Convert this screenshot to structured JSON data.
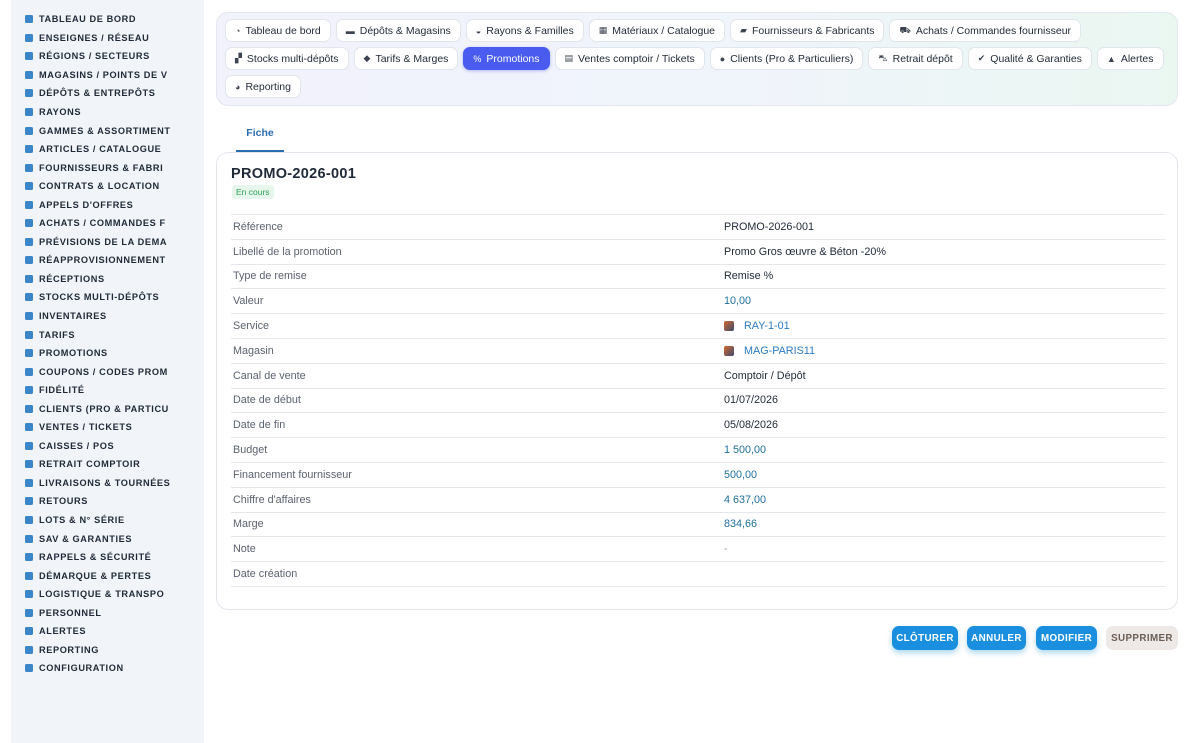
{
  "sidebar": {
    "items": [
      {
        "label": "TABLEAU DE BORD",
        "icon": "dashboard-icon"
      },
      {
        "label": "ENSEIGNES / RÉSEAU",
        "icon": "flag-icon"
      },
      {
        "label": "RÉGIONS / SECTEURS",
        "icon": "map-icon"
      },
      {
        "label": "MAGASINS / POINTS DE V",
        "icon": "store-icon"
      },
      {
        "label": "DÉPÔTS & ENTREPÔTS",
        "icon": "warehouse-icon"
      },
      {
        "label": "RAYONS",
        "icon": "shelf-icon"
      },
      {
        "label": "GAMMES & ASSORTIMENT",
        "icon": "box-icon"
      },
      {
        "label": "ARTICLES / CATALOGUE",
        "icon": "catalog-icon"
      },
      {
        "label": "FOURNISSEURS & FABRI",
        "icon": "truck-icon"
      },
      {
        "label": "CONTRATS & LOCATION",
        "icon": "document-icon"
      },
      {
        "label": "APPELS D'OFFRES",
        "icon": "hammer-icon"
      },
      {
        "label": "ACHATS / COMMANDES F",
        "icon": "cart-icon"
      },
      {
        "label": "PRÉVISIONS DE LA DEMA",
        "icon": "trend-icon"
      },
      {
        "label": "RÉAPPROVISIONNEMENT",
        "icon": "refresh-icon"
      },
      {
        "label": "RÉCEPTIONS",
        "icon": "dolly-icon"
      },
      {
        "label": "STOCKS MULTI-DÉPÔTS",
        "icon": "stock-icon"
      },
      {
        "label": "INVENTAIRES",
        "icon": "clipboard-icon"
      },
      {
        "label": "TARIFS",
        "icon": "tag-icon"
      },
      {
        "label": "PROMOTIONS",
        "icon": "percent-icon"
      },
      {
        "label": "COUPONS / CODES PROM",
        "icon": "ticket-icon"
      },
      {
        "label": "FIDÉLITÉ",
        "icon": "heart-icon"
      },
      {
        "label": "CLIENTS (PRO & PARTICU",
        "icon": "user-icon"
      },
      {
        "label": "VENTES / TICKETS",
        "icon": "receipt-icon"
      },
      {
        "label": "CAISSES / POS",
        "icon": "register-icon"
      },
      {
        "label": "RETRAIT COMPTOIR",
        "icon": "car-icon"
      },
      {
        "label": "LIVRAISONS & TOURNÉES",
        "icon": "delivery-icon"
      },
      {
        "label": "RETOURS",
        "icon": "undo-icon"
      },
      {
        "label": "LOTS & N° SÉRIE",
        "icon": "barcode-icon"
      },
      {
        "label": "SAV & GARANTIES",
        "icon": "tools-icon"
      },
      {
        "label": "RAPPELS & SÉCURITÉ",
        "icon": "warning-icon"
      },
      {
        "label": "DÉMARQUE & PERTES",
        "icon": "trash-icon"
      },
      {
        "label": "LOGISTIQUE & TRANSPO",
        "icon": "shipping-icon"
      },
      {
        "label": "PERSONNEL",
        "icon": "people-icon"
      },
      {
        "label": "ALERTES",
        "icon": "bell-icon"
      },
      {
        "label": "REPORTING",
        "icon": "chart-icon"
      },
      {
        "label": "CONFIGURATION",
        "icon": "gear-icon"
      }
    ]
  },
  "tabs": {
    "row1": [
      {
        "label": "Tableau de bord",
        "icon": "dashboard-icon",
        "glyph": "◔"
      },
      {
        "label": "Dépôts & Magasins",
        "icon": "warehouse-icon",
        "glyph": "▬"
      },
      {
        "label": "Rayons & Familles",
        "icon": "basket-icon",
        "glyph": "◒"
      },
      {
        "label": "Matériaux / Catalogue",
        "icon": "box-icon",
        "glyph": "▦"
      },
      {
        "label": "Fournisseurs & Fabricants",
        "icon": "truck-icon",
        "glyph": "▰"
      },
      {
        "label": "Achats / Commandes fournisseur",
        "icon": "cart-icon",
        "glyph": "⛟"
      }
    ],
    "row2": [
      {
        "label": "Stocks multi-dépôts",
        "icon": "stock-icon",
        "glyph": "▞"
      },
      {
        "label": "Tarifs & Marges",
        "icon": "tag-icon",
        "glyph": "◆"
      },
      {
        "label": "Promotions",
        "icon": "percent-icon",
        "glyph": "%",
        "active": true
      },
      {
        "label": "Ventes comptoir / Tickets",
        "icon": "receipt-icon",
        "glyph": "▤"
      },
      {
        "label": "Clients (Pro & Particuliers)",
        "icon": "user-icon",
        "glyph": "●"
      },
      {
        "label": "Retrait dépôt",
        "icon": "car-icon",
        "glyph": "⛍"
      },
      {
        "label": "Qualité & Garanties",
        "icon": "check-icon",
        "glyph": "✔"
      },
      {
        "label": "Alertes",
        "icon": "bell-icon",
        "glyph": "▲"
      }
    ],
    "row3": [
      {
        "label": "Reporting",
        "icon": "chart-icon",
        "glyph": "◕"
      }
    ]
  },
  "subtab": {
    "label": "Fiche"
  },
  "record": {
    "title": "PROMO-2026-001",
    "status": "En cours",
    "fields": [
      {
        "key": "Référence",
        "value": "PROMO-2026-001",
        "kind": "text"
      },
      {
        "key": "Libellé de la promotion",
        "value": "Promo Gros œuvre & Béton -20%",
        "kind": "text"
      },
      {
        "key": "Type de remise",
        "value": "Remise %",
        "kind": "text"
      },
      {
        "key": "Valeur",
        "value": "10,00",
        "kind": "num"
      },
      {
        "key": "Service",
        "value": "RAY-1-01",
        "kind": "link"
      },
      {
        "key": "Magasin",
        "value": "MAG-PARIS11",
        "kind": "link"
      },
      {
        "key": "Canal de vente",
        "value": "Comptoir / Dépôt",
        "kind": "text"
      },
      {
        "key": "Date de début",
        "value": "01/07/2026",
        "kind": "text"
      },
      {
        "key": "Date de fin",
        "value": "05/08/2026",
        "kind": "text"
      },
      {
        "key": "Budget",
        "value": "1 500,00",
        "kind": "num"
      },
      {
        "key": "Financement fournisseur",
        "value": "500,00",
        "kind": "num"
      },
      {
        "key": "Chiffre d'affaires",
        "value": "4 637,00",
        "kind": "num"
      },
      {
        "key": "Marge",
        "value": "834,66",
        "kind": "num"
      },
      {
        "key": "Note",
        "value": "-",
        "kind": "dash"
      },
      {
        "key": "Date création",
        "value": "",
        "kind": "text"
      }
    ]
  },
  "actions": {
    "close_label": "CLÔTURER",
    "cancel_label": "ANNULER",
    "edit_label": "MODIFIER",
    "delete_label": "SUPPRIMER"
  },
  "colors": {
    "accent": "#4a5bf0",
    "primary_button": "#1a8fe0",
    "status_green": "#2f9e55",
    "sidebar_icon": "#3a86c8"
  }
}
